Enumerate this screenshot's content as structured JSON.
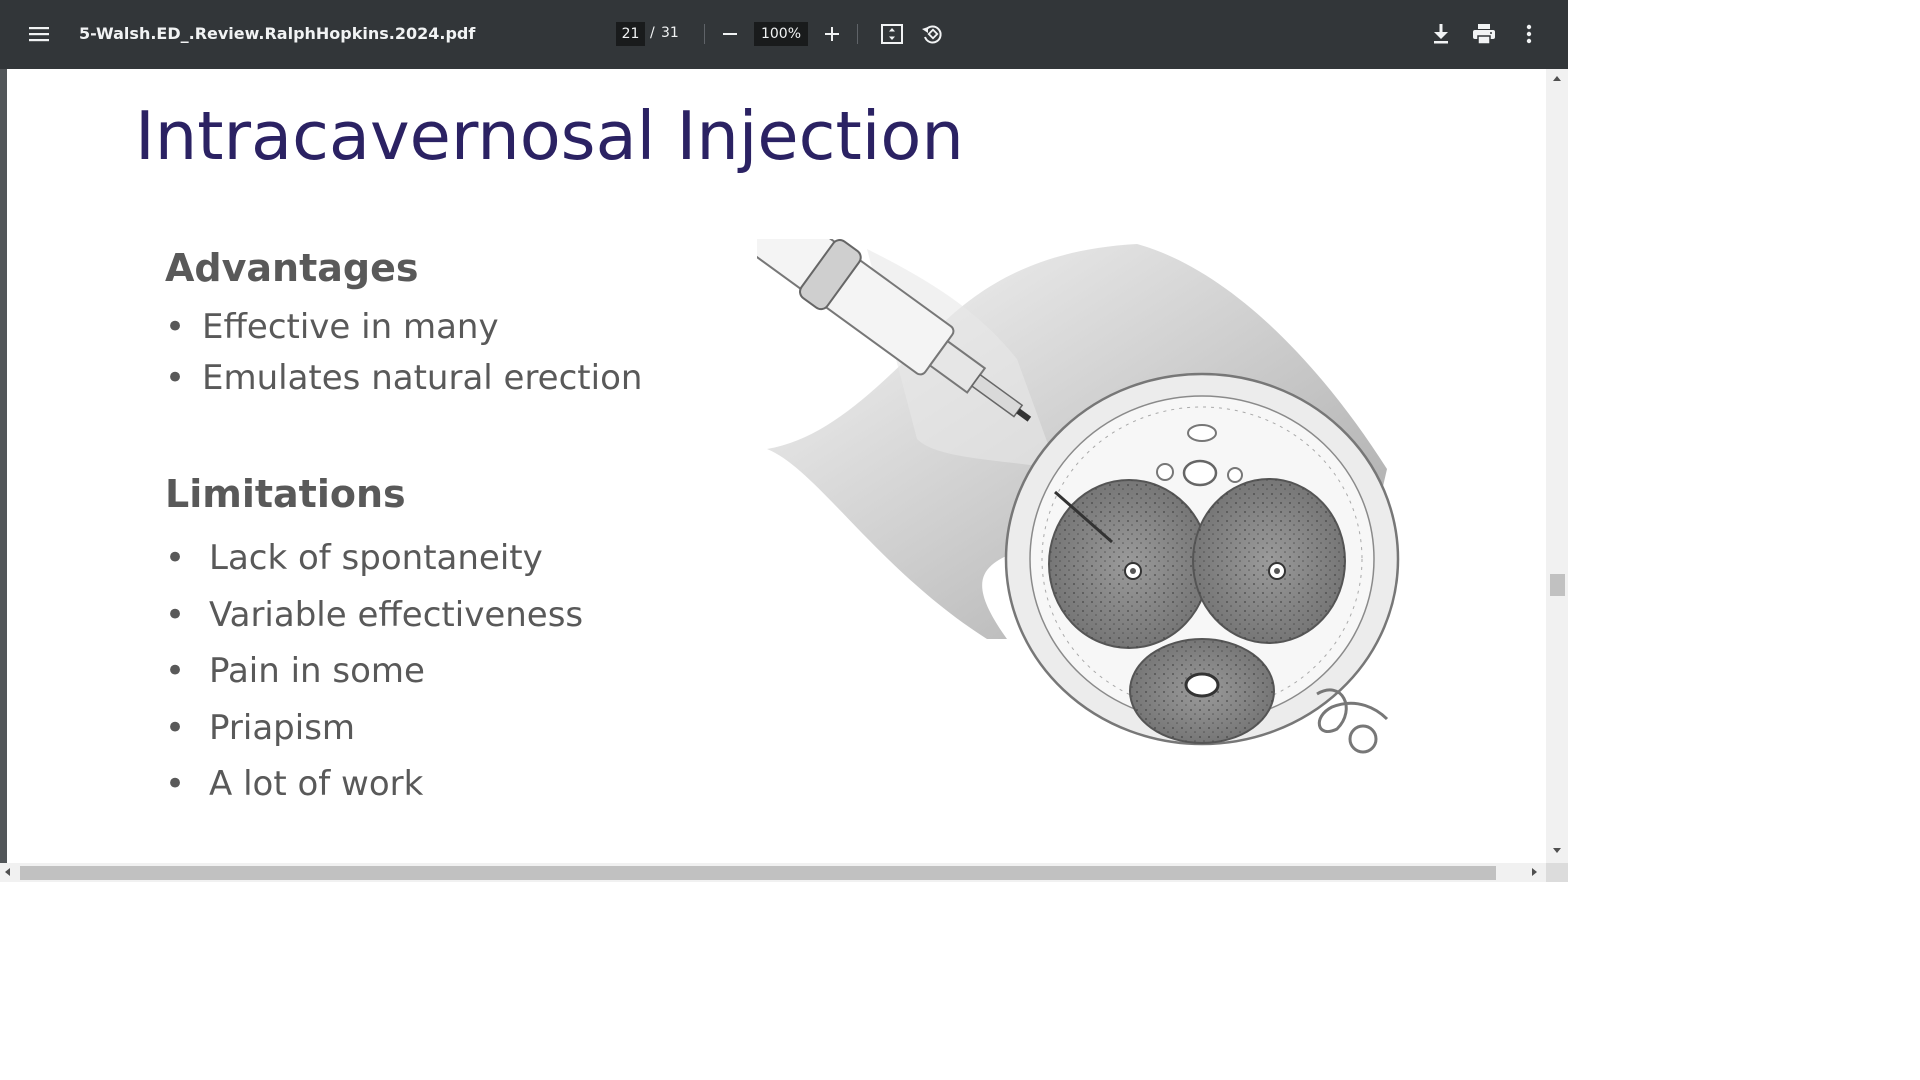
{
  "toolbar": {
    "file_name": "5-Walsh.ED_.Review.RalphHopkins.2024.pdf",
    "current_page": "21",
    "page_separator": "/",
    "total_pages": "31",
    "zoom_level": "100%",
    "icons": {
      "menu": "hamburger-menu-icon",
      "zoom_out": "minus-icon",
      "zoom_in": "plus-icon",
      "fit": "fit-to-page-icon",
      "rotate": "rotate-counterclockwise-icon",
      "download": "download-icon",
      "print": "print-icon",
      "more": "more-vertical-icon"
    },
    "colors": {
      "background": "#323639",
      "text": "#f1f3f4",
      "input_bg": "#191b1c"
    }
  },
  "slide": {
    "title": "Intracavernosal Injection",
    "advantages": {
      "heading": "Advantages",
      "items": [
        "Effective in many",
        "Emulates natural erection"
      ]
    },
    "limitations": {
      "heading": "Limitations",
      "items": [
        "Lack of spontaneity",
        "Variable effectiveness",
        "Pain in some",
        "Priapism",
        "A lot of work"
      ]
    },
    "bullet": "•",
    "colors": {
      "title": "#2b2263",
      "body": "#595959"
    }
  },
  "viewer": {
    "background": "#525659"
  }
}
